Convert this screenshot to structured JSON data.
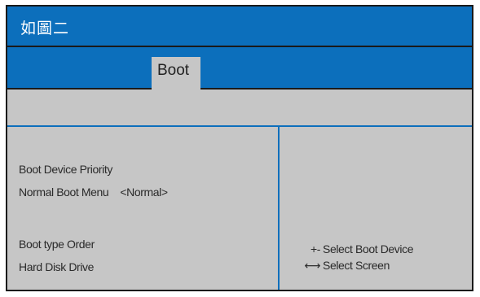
{
  "title_bar": {
    "title": "如圖二"
  },
  "tabs": [
    {
      "label": "Boot",
      "active": true
    }
  ],
  "main": {
    "items": [
      {
        "label": "Boot Device Priority"
      },
      {
        "label": "Normal Boot Menu",
        "value": "<Normal>"
      },
      {
        "label": "Boot type Order"
      },
      {
        "label": "Hard Disk Drive"
      }
    ]
  },
  "help": {
    "lines": [
      {
        "key": "+-",
        "text": "Select Boot Device"
      },
      {
        "key": "⟷",
        "text": "Select Screen"
      }
    ]
  },
  "colors": {
    "accent_blue": "#0c6fbc",
    "panel_gray": "#c6c6c6",
    "text_dark": "#2a2a2a",
    "title_text": "#ffffff"
  }
}
